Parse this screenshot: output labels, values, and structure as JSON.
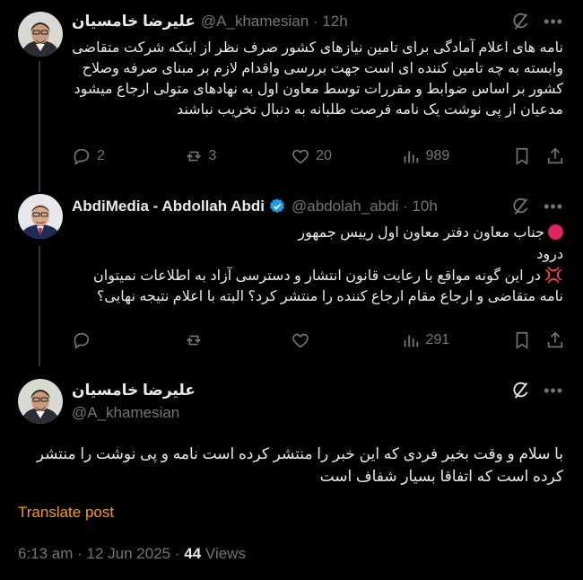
{
  "tweets": [
    {
      "name": "علیرضا خامسیان",
      "handle": "@A_khamesian",
      "time": "12h",
      "body": "نامه های اعلام آمادگی برای تامین نیازهای کشور صرف نظر از اینکه شرکت متقاضی وابسته به چه تامین کننده ای است جهت بررسی واقدام لازم بر مبنای صرفه وصلاح کشور بر اساس ضوابط و مقررات توسط معاون اول به نهادهای متولی ارجاع میشود مدعیان از پی نوشت یک نامه فرصت طلبانه به دنبال تخریب نباشند",
      "replies": "2",
      "reposts": "3",
      "likes": "20",
      "views": "989"
    },
    {
      "name": "AbdiMedia - Abdollah Abdi",
      "handle": "@abdolah_abdi",
      "time": "10h",
      "line1": "جناب معاون دفتر معاون اول رییس جمهور",
      "line2": "درود",
      "line3": "در این گونه مواقع با رعایت قانون انتشار و دسترسی آزاد به اطلاعات نمیتوان نامه متقاضی و ارجاع مقام ارجاع کننده را منتشر کرد؟ البته با اعلام نتیجه نهایی؟",
      "replies": "",
      "reposts": "",
      "likes": "",
      "views": "291"
    },
    {
      "name": "علیرضا خامسیان",
      "handle": "@A_khamesian",
      "body": "با سلام و وقت بخیر فردی که این خبر را منتشر کرده است نامه و پی نوشت را منتشر کرده است که اتفاقا بسیار شفاف است"
    }
  ],
  "translate_label": "Translate post",
  "meta": {
    "time": "6:13 am",
    "sep": " · ",
    "date": "12 Jun 2025",
    "views_count": "44",
    "views_label": "Views"
  },
  "colors": {
    "background": "#000000",
    "text": "#e7e9ea",
    "muted": "#71767b",
    "translate": "#f59e0b",
    "verified": "#1d9bf0"
  },
  "icons": {
    "header": [
      "grok-icon",
      "more-icon"
    ],
    "actions": [
      "reply-icon",
      "repost-icon",
      "like-icon",
      "views-icon",
      "bookmark-icon",
      "share-icon"
    ]
  }
}
